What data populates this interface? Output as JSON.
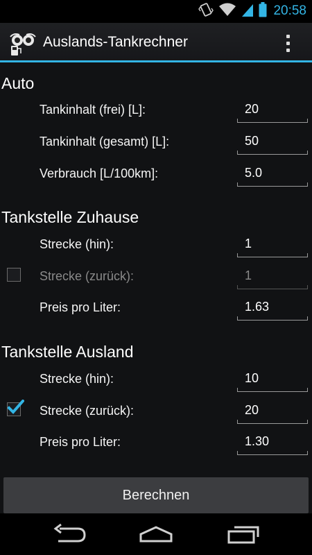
{
  "status_bar": {
    "time": "20:58",
    "icons": [
      "vibrate-icon",
      "wifi-icon",
      "signal-icon",
      "battery-icon"
    ],
    "accent_color": "#33b5e5"
  },
  "action_bar": {
    "title": "Auslands-Tankrechner",
    "app_icon": "app-icon",
    "menu_icon": "overflow-menu-icon"
  },
  "sections": {
    "auto": {
      "title": "Auto",
      "rows": [
        {
          "label": "Tankinhalt (frei) [L]:",
          "value": "20"
        },
        {
          "label": "Tankinhalt (gesamt) [L]:",
          "value": "50"
        },
        {
          "label": "Verbrauch [L/100km]:",
          "value": "5.0"
        }
      ]
    },
    "home": {
      "title": "Tankstelle Zuhause",
      "rows": [
        {
          "label": "Strecke (hin):",
          "value": "1"
        },
        {
          "label": "Strecke (zurück):",
          "value": "1",
          "checked": false,
          "enabled": false
        },
        {
          "label": "Preis pro Liter:",
          "value": "1.63"
        }
      ]
    },
    "abroad": {
      "title": "Tankstelle Ausland",
      "rows": [
        {
          "label": "Strecke (hin):",
          "value": "10"
        },
        {
          "label": "Strecke (zurück):",
          "value": "20",
          "checked": true,
          "enabled": true
        },
        {
          "label": "Preis pro Liter:",
          "value": "1.30"
        }
      ]
    }
  },
  "calculate_button": {
    "label": "Berechnen"
  },
  "nav_bar": {
    "buttons": [
      "back-icon",
      "home-icon",
      "recent-apps-icon"
    ]
  }
}
